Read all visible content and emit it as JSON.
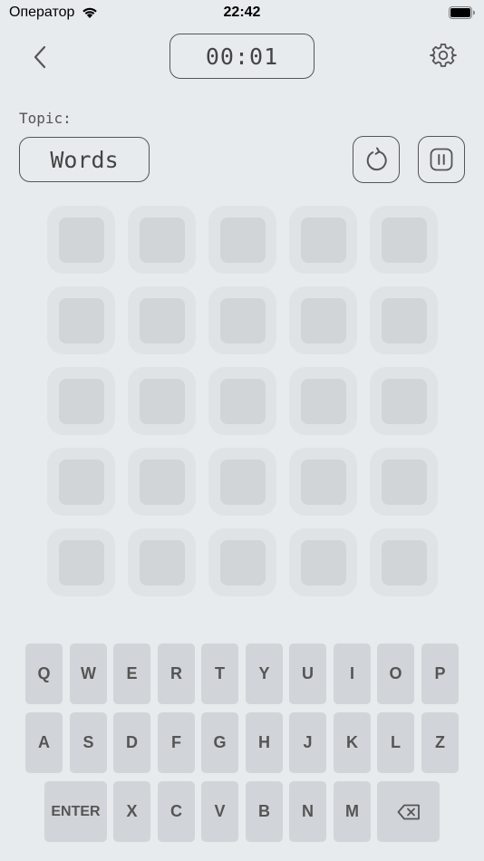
{
  "status": {
    "carrier": "Оператор",
    "time": "22:42"
  },
  "header": {
    "timer": "00:01"
  },
  "topic": {
    "label": "Topic:",
    "value": "Words"
  },
  "icons": {
    "back": "chevron-left-icon",
    "settings": "gear-icon",
    "restart": "restart-icon",
    "pause": "pause-icon",
    "backspace": "backspace-icon"
  },
  "grid": {
    "rows": 5,
    "cols": 5,
    "letters": [
      "",
      "",
      "",
      "",
      "",
      "",
      "",
      "",
      "",
      "",
      "",
      "",
      "",
      "",
      "",
      "",
      "",
      "",
      "",
      "",
      "",
      "",
      "",
      "",
      ""
    ]
  },
  "keyboard": {
    "row1": [
      "Q",
      "W",
      "E",
      "R",
      "T",
      "Y",
      "U",
      "I",
      "O",
      "P"
    ],
    "row2": [
      "A",
      "S",
      "D",
      "F",
      "G",
      "H",
      "J",
      "K",
      "L",
      "Z"
    ],
    "row3": [
      "ENTER",
      "X",
      "C",
      "V",
      "B",
      "N",
      "M",
      "⌫"
    ]
  },
  "colors": {
    "background": "#e7ebee",
    "key": "#d1d5d9",
    "cell_outer": "#e0e3e6",
    "cell_inner": "#d2d5d8",
    "border": "#555555"
  }
}
